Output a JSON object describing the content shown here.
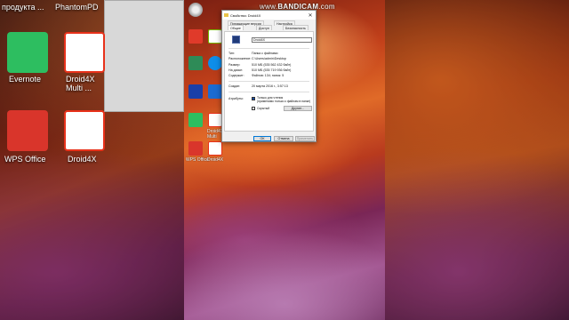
{
  "watermark": {
    "prefix": "www.",
    "brand": "BANDICAM",
    "suffix": ".com"
  },
  "left_side": {
    "top_texts": [
      "продукта ...",
      "PhantomPD"
    ],
    "icons": [
      {
        "label": "Evernote",
        "icon": "evernote-icon",
        "color": "#2dbe60"
      },
      {
        "label": "Droid4X\nMulti ...",
        "icon": "droid4x-icon",
        "color": "#e8311a"
      },
      {
        "label": "WPS Office",
        "icon": "wps-office-icon",
        "color": "#d9352b"
      },
      {
        "label": "Droid4X",
        "icon": "droid4x-icon",
        "color": "#e8311a"
      }
    ]
  },
  "desktop_icons": [
    {
      "label": "",
      "icon": "cd-icon",
      "color": "#c8c8c8"
    },
    {
      "label": "",
      "icon": "app-icon",
      "color": "#e03a2a"
    },
    {
      "label": "",
      "icon": "nvidia-icon",
      "color": "#76b900"
    },
    {
      "label": "",
      "icon": "app-icon",
      "color": "#d43d2a"
    },
    {
      "label": "",
      "icon": "app-icon",
      "color": "#2e8b57"
    },
    {
      "label": "",
      "icon": "teamviewer-icon",
      "color": "#0e8ee9"
    },
    {
      "label": "",
      "icon": "asus-icon",
      "color": "#1a3fa8"
    },
    {
      "label": "",
      "icon": "app-icon",
      "color": "#1c6bd1"
    },
    {
      "label": "",
      "icon": "evernote-icon",
      "color": "#2dbe60"
    },
    {
      "label": "Droid4X\nMulti",
      "icon": "droid4x-icon",
      "color": "#e8311a"
    },
    {
      "label": "WPS Office",
      "icon": "wps-office-icon",
      "color": "#d9352b"
    },
    {
      "label": "Droid4X",
      "icon": "droid4x-icon",
      "color": "#e8311a"
    }
  ],
  "dialog": {
    "title": "Свойства: Droid4X",
    "close_glyph": "✕",
    "tabs_back": [
      "Предыдущие версии",
      "Настройка"
    ],
    "tabs_front": [
      "Общие",
      "Доступ",
      "Безопасность"
    ],
    "name_value": "Droid4X",
    "rows": [
      {
        "label": "Тип:",
        "value": "Папка с файлами"
      },
      {
        "label": "Расположение:",
        "value": "C:\\Users\\admin\\Desktop"
      },
      {
        "label": "Размер:",
        "value": "510 МБ (535 562 432 байт)"
      },
      {
        "label": "На диске:",
        "value": "510 МБ (535 719 936 байт)"
      },
      {
        "label": "Содержит:",
        "value": "Файлов: 134; папок: 5"
      },
      {
        "label": "Создан:",
        "value": "20 марта 2016 г., 3:57:13"
      }
    ],
    "attributes_label": "Атрибуты:",
    "readonly_text": "Только для чтения",
    "readonly_sub": "(применимо только к файлам в папке)",
    "hidden_text": "Скрытый",
    "other_button": "Другие...",
    "buttons": [
      "ОК",
      "Отмена",
      "Применить"
    ]
  }
}
